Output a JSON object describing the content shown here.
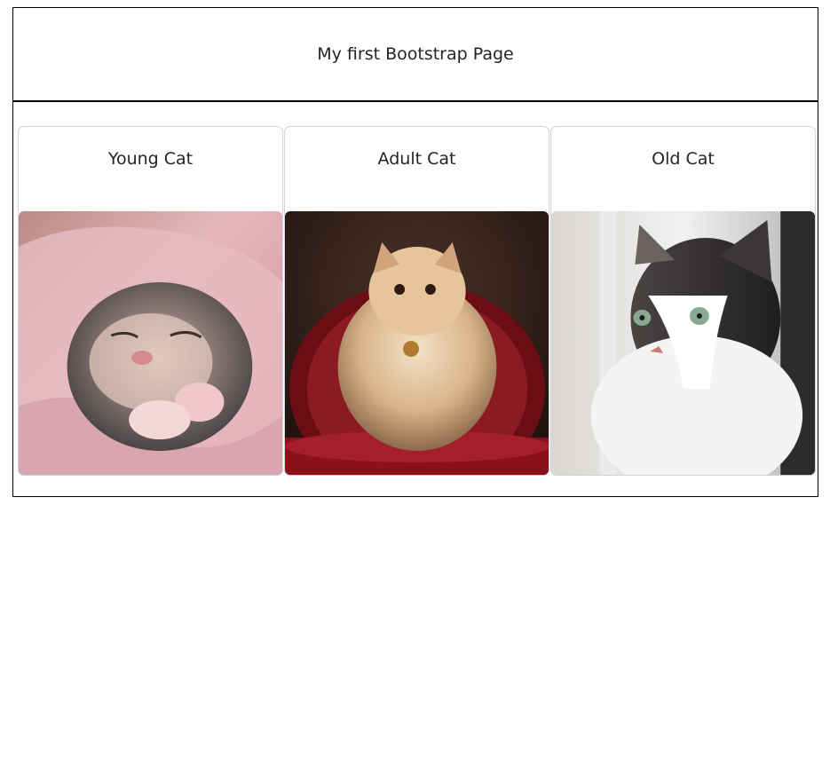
{
  "header": {
    "title": "My first Bootstrap Page"
  },
  "cards": [
    {
      "title": "Young Cat",
      "image": "sleeping-kitten-photo"
    },
    {
      "title": "Adult Cat",
      "image": "persian-cat-on-red-chair-photo"
    },
    {
      "title": "Old Cat",
      "image": "cat-by-window-photo"
    }
  ]
}
